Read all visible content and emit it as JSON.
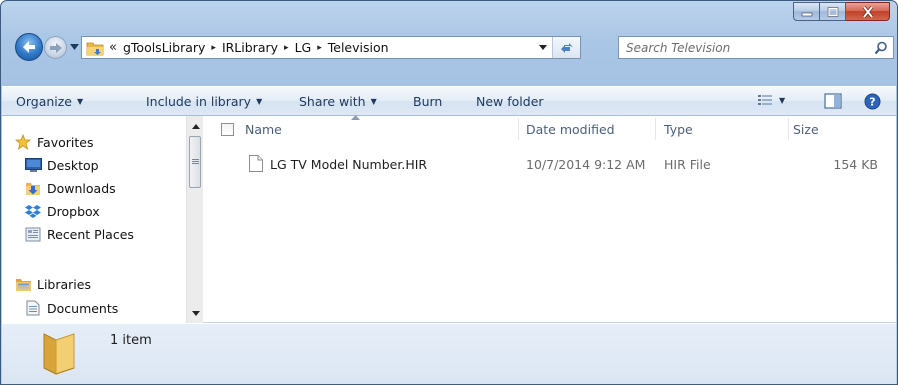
{
  "window": {
    "title": "",
    "colors": {
      "accent": "#1e395b",
      "close": "#c0402a"
    }
  },
  "caption_buttons": {
    "minimize": "minimize-icon",
    "maximize": "maximize-icon",
    "close": "close-icon"
  },
  "address_bar": {
    "overflow": "«",
    "crumbs": [
      "gToolsLibrary",
      "IRLibrary",
      "LG",
      "Television"
    ],
    "separator": "▸"
  },
  "search": {
    "placeholder": "Search Television"
  },
  "command_bar": {
    "organize": "Organize",
    "include": "Include in library",
    "share": "Share with",
    "burn": "Burn",
    "new_folder": "New folder"
  },
  "nav_pane": {
    "favorites": {
      "label": "Favorites",
      "icon": "star-icon"
    },
    "items": [
      {
        "label": "Desktop",
        "icon": "desktop-icon"
      },
      {
        "label": "Downloads",
        "icon": "downloads-icon"
      },
      {
        "label": "Dropbox",
        "icon": "dropbox-icon"
      },
      {
        "label": "Recent Places",
        "icon": "recent-places-icon"
      }
    ],
    "libraries": {
      "label": "Libraries",
      "icon": "libraries-icon"
    },
    "library_items": [
      {
        "label": "Documents",
        "icon": "documents-icon"
      }
    ]
  },
  "file_list": {
    "columns": {
      "name": "Name",
      "date": "Date modified",
      "type": "Type",
      "size": "Size"
    },
    "rows": [
      {
        "name": "LG TV Model Number.HIR",
        "date": "10/7/2014 9:12 AM",
        "type": "HIR File",
        "size": "154 KB"
      }
    ]
  },
  "details_pane": {
    "count": "1 item"
  }
}
